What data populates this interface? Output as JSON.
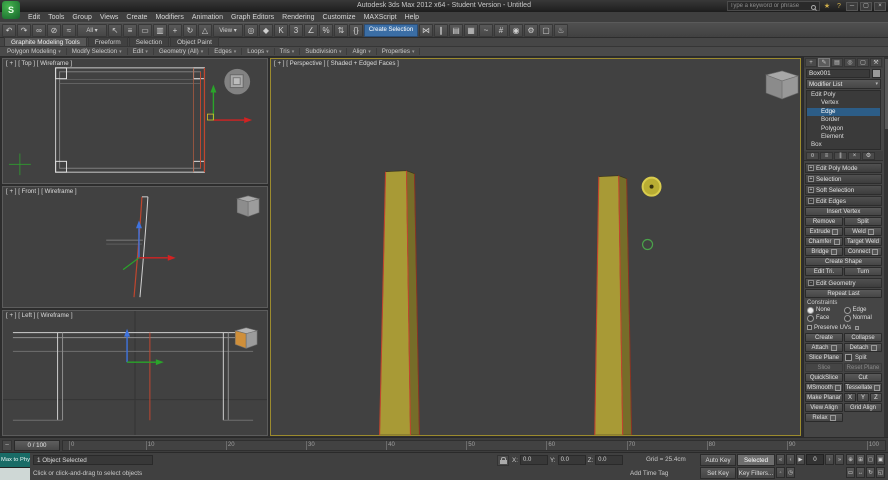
{
  "window": {
    "title": "Autodesk 3ds Max 2012 x64 - Student Version - Untitled",
    "search_placeholder": "Type a keyword or phrase"
  },
  "colors": {
    "selection_blue": "#2c5d87",
    "object_olive": "#a89a36",
    "selected_edge_red": "#c0462e",
    "brush_yellow": "#b9ad33",
    "listener_teal": "#196b66"
  },
  "menubar": [
    {
      "name": "menu-edit",
      "label": "Edit"
    },
    {
      "name": "menu-tools",
      "label": "Tools"
    },
    {
      "name": "menu-group",
      "label": "Group"
    },
    {
      "name": "menu-views",
      "label": "Views"
    },
    {
      "name": "menu-create",
      "label": "Create"
    },
    {
      "name": "menu-modifiers",
      "label": "Modifiers"
    },
    {
      "name": "menu-animation",
      "label": "Animation"
    },
    {
      "name": "menu-graph-editors",
      "label": "Graph Editors"
    },
    {
      "name": "menu-rendering",
      "label": "Rendering"
    },
    {
      "name": "menu-customize",
      "label": "Customize"
    },
    {
      "name": "menu-maxscript",
      "label": "MAXScript"
    },
    {
      "name": "menu-help",
      "label": "Help"
    }
  ],
  "toolbar": {
    "items": [
      {
        "name": "undo-icon",
        "glyph": "↶"
      },
      {
        "name": "redo-icon",
        "glyph": "↷"
      },
      {
        "name": "select-and-link-icon",
        "glyph": "∞"
      },
      {
        "name": "unlink-selection-icon",
        "glyph": "⊘"
      },
      {
        "name": "bind-to-space-warp-icon",
        "glyph": "≈"
      },
      {
        "name": "selection-filter-dropdown",
        "cls": "drop",
        "glyph": "All ▾"
      },
      {
        "name": "select-object-icon",
        "glyph": "↖"
      },
      {
        "name": "select-by-name-icon",
        "glyph": "≡"
      },
      {
        "name": "rectangular-selection-region-icon",
        "glyph": "▭"
      },
      {
        "name": "window-crossing-toggle-icon",
        "glyph": "▥"
      },
      {
        "name": "select-and-move-icon",
        "glyph": "+"
      },
      {
        "name": "select-and-rotate-icon",
        "glyph": "↻"
      },
      {
        "name": "select-and-scale-icon",
        "glyph": "△"
      },
      {
        "name": "reference-coordinate-dropdown",
        "cls": "drop",
        "glyph": "View ▾"
      },
      {
        "name": "use-pivot-point-center-icon",
        "glyph": "◎"
      },
      {
        "name": "select-and-manipulate-icon",
        "glyph": "◆"
      },
      {
        "name": "keyboard-shortcut-override-icon",
        "glyph": "K"
      },
      {
        "name": "snaps-toggle-icon",
        "glyph": "3"
      },
      {
        "name": "angle-snap-toggle-icon",
        "glyph": "∠"
      },
      {
        "name": "percent-snap-toggle-icon",
        "glyph": "%"
      },
      {
        "name": "spinner-snap-toggle-icon",
        "glyph": "⇅"
      },
      {
        "name": "edit-named-selection-sets-icon",
        "glyph": "{}"
      },
      {
        "name": "named-selection-set-dropdown",
        "cls": "drop wide",
        "glyph": "Create Selection"
      },
      {
        "name": "mirror-icon",
        "glyph": "⋈"
      },
      {
        "name": "align-icon",
        "glyph": "∥"
      },
      {
        "name": "layer-manager-icon",
        "glyph": "▤"
      },
      {
        "name": "graphite-ribbon-toggle-icon",
        "glyph": "▦"
      },
      {
        "name": "curve-editor-icon",
        "glyph": "~"
      },
      {
        "name": "schematic-view-icon",
        "glyph": "#"
      },
      {
        "name": "material-editor-icon",
        "glyph": "◉"
      },
      {
        "name": "render-setup-icon",
        "glyph": "⚙"
      },
      {
        "name": "rendered-frame-window-icon",
        "glyph": "▢"
      },
      {
        "name": "render-production-icon",
        "glyph": "♨"
      }
    ]
  },
  "ribbon": {
    "tabs": [
      {
        "name": "tab-graphite-modeling-tools",
        "label": "Graphite Modeling Tools",
        "cls": "active"
      },
      {
        "name": "tab-freeform",
        "label": "Freeform"
      },
      {
        "name": "tab-selection",
        "label": "Selection"
      },
      {
        "name": "tab-object-paint",
        "label": "Object Paint"
      }
    ],
    "panels": [
      {
        "name": "panel-polygon-modeling",
        "label": "Polygon Modeling"
      },
      {
        "name": "panel-modify-selection",
        "label": "Modify Selection"
      },
      {
        "name": "panel-edit",
        "label": "Edit"
      },
      {
        "name": "panel-geometry-all",
        "label": "Geometry (All)"
      },
      {
        "name": "panel-edges",
        "label": "Edges"
      },
      {
        "name": "panel-loops",
        "label": "Loops"
      },
      {
        "name": "panel-tris",
        "label": "Tris"
      },
      {
        "name": "panel-subdivision",
        "label": "Subdivision"
      },
      {
        "name": "panel-align",
        "label": "Align"
      },
      {
        "name": "panel-properties",
        "label": "Properties"
      }
    ]
  },
  "viewports": {
    "top_label": "[ + ] [ Top ] [ Wireframe ]",
    "front_label": "[ + ] [ Front ] [ Wireframe ]",
    "left_label": "[ + ] [ Left ] [ Wireframe ]",
    "persp_label": "[ + ] [ Perspective ] [ Shaded + Edged Faces ]"
  },
  "command_panel": {
    "tabs": [
      {
        "name": "create-tab",
        "glyph": "+"
      },
      {
        "name": "modify-tab",
        "glyph": "✎",
        "cls": "active"
      },
      {
        "name": "hierarchy-tab",
        "glyph": "▤"
      },
      {
        "name": "motion-tab",
        "glyph": "◎"
      },
      {
        "name": "display-tab",
        "glyph": "▢"
      },
      {
        "name": "utilities-tab",
        "glyph": "⚒"
      }
    ],
    "object_name": "Box001",
    "modifier_list": "Modifier List",
    "stack": [
      {
        "name": "stack-edit-poly",
        "label": "Edit Poly"
      },
      {
        "name": "stack-vertex",
        "label": "Vertex",
        "cls": "ind"
      },
      {
        "name": "stack-edge",
        "label": "Edge",
        "cls": "ind sel"
      },
      {
        "name": "stack-border",
        "label": "Border",
        "cls": "ind"
      },
      {
        "name": "stack-polygon",
        "label": "Polygon",
        "cls": "ind"
      },
      {
        "name": "stack-element",
        "label": "Element",
        "cls": "ind"
      },
      {
        "name": "stack-box",
        "label": "Box"
      }
    ],
    "stack_tools": [
      {
        "name": "pin-stack-button",
        "glyph": "¤"
      },
      {
        "name": "show-end-result-button",
        "glyph": "≡"
      },
      {
        "name": "make-unique-button",
        "glyph": "∥"
      },
      {
        "name": "remove-modifier-button",
        "glyph": "×"
      },
      {
        "name": "configure-modifier-sets-button",
        "glyph": "⚙"
      }
    ],
    "rollouts_collapsed": [
      {
        "name": "rollout-edit-poly-mode",
        "state": "+",
        "label": "Edit Poly Mode"
      },
      {
        "name": "rollout-selection",
        "state": "+",
        "label": "Selection"
      },
      {
        "name": "rollout-soft-selection",
        "state": "+",
        "label": "Soft Selection"
      }
    ],
    "edit_edges": {
      "state": "-",
      "title": "Edit Edges",
      "buttons": [
        {
          "name": "insert-vertex-button",
          "label": "Insert Vertex",
          "cls": "full"
        },
        {
          "name": "remove-button",
          "label": "Remove"
        },
        {
          "name": "split-button",
          "label": "Split"
        },
        {
          "name": "extrude-button",
          "label": "Extrude",
          "cls": "set"
        },
        {
          "name": "weld-button",
          "label": "Weld",
          "cls": "set"
        },
        {
          "name": "chamfer-button",
          "label": "Chamfer",
          "cls": "set"
        },
        {
          "name": "target-weld-button",
          "label": "Target Weld"
        },
        {
          "name": "bridge-button",
          "label": "Bridge",
          "cls": "set"
        },
        {
          "name": "connect-button",
          "label": "Connect",
          "cls": "set"
        },
        {
          "name": "create-shape-button",
          "label": "Create Shape",
          "cls": "full"
        },
        {
          "name": "edit-tri-button",
          "label": "Edit Tri."
        },
        {
          "name": "turn-button",
          "label": "Turn"
        }
      ]
    },
    "edit_geometry": {
      "state": "-",
      "title": "Edit Geometry",
      "buttons_top": [
        {
          "name": "repeat-last-button",
          "label": "Repeat Last",
          "cls": "full"
        }
      ],
      "constraints": {
        "label": "Constraints",
        "options": [
          {
            "name": "constraint-none-radio",
            "label": "None",
            "cls": "sel"
          },
          {
            "name": "constraint-edge-radio",
            "label": "Edge"
          },
          {
            "name": "constraint-face-radio",
            "label": "Face"
          },
          {
            "name": "constraint-normal-radio",
            "label": "Normal"
          }
        ]
      },
      "preserve_uvs_label": "Preserve UVs",
      "buttons": [
        {
          "name": "create-button",
          "label": "Create"
        },
        {
          "name": "collapse-button",
          "label": "Collapse"
        },
        {
          "name": "attach-button",
          "label": "Attach",
          "cls": "set"
        },
        {
          "name": "detach-button",
          "label": "Detach",
          "cls": "set"
        },
        {
          "name": "slice-plane-button",
          "label": "Slice Plane"
        },
        {
          "name": "split-checkbox",
          "label": "Split",
          "cls": "check"
        },
        {
          "name": "slice-button",
          "label": "Slice",
          "cls": "disabled"
        },
        {
          "name": "reset-plane-button",
          "label": "Reset Plane",
          "cls": "disabled"
        },
        {
          "name": "quickslice-button",
          "label": "QuickSlice"
        },
        {
          "name": "cut-button",
          "label": "Cut"
        },
        {
          "name": "msmooth-button",
          "label": "MSmooth",
          "cls": "set"
        },
        {
          "name": "tessellate-button",
          "label": "Tessellate",
          "cls": "set"
        },
        {
          "name": "make-planar-button",
          "label": "Make Planar"
        },
        {
          "name": "make-planar-x-button",
          "label": "X",
          "cls": "tiny"
        },
        {
          "name": "make-planar-y-button",
          "label": "Y",
          "cls": "tiny"
        },
        {
          "name": "make-planar-z-button",
          "label": "Z",
          "cls": "tiny"
        },
        {
          "name": "view-align-button",
          "label": "View Align"
        },
        {
          "name": "grid-align-button",
          "label": "Grid Align"
        },
        {
          "name": "relax-button",
          "label": "Relax",
          "cls": "set"
        }
      ]
    }
  },
  "timeline": {
    "slider_label": "0 / 100",
    "ticks": [
      "0",
      "10",
      "20",
      "30",
      "40",
      "50",
      "60",
      "70",
      "80",
      "90",
      "100"
    ]
  },
  "statusbar": {
    "listener_label": "Max to Physx",
    "status": "1 Object Selected",
    "prompt": "Click or click-and-drag to select objects",
    "coords": {
      "x_label": "X:",
      "y_label": "Y:",
      "z_label": "Z:",
      "x": "0.0",
      "y": "0.0",
      "z": "0.0"
    },
    "grid": "Grid = 25.4cm",
    "time_tag": "Add Time Tag",
    "auto_key": "Auto Key",
    "set_key": "Set Key",
    "selected_mode": "Selected",
    "key_filters": "Key Filters...",
    "frame": "0",
    "transport_left": [
      {
        "name": "go-to-start-button",
        "glyph": "«"
      },
      {
        "name": "previous-frame-button",
        "glyph": "‹"
      },
      {
        "name": "play-button",
        "glyph": "▶"
      }
    ],
    "transport_right": [
      {
        "name": "next-frame-button",
        "glyph": "›"
      },
      {
        "name": "go-to-end-button",
        "glyph": "»"
      }
    ],
    "transport_row2": [
      {
        "name": "key-mode-toggle-button",
        "glyph": "◦"
      },
      {
        "name": "time-configuration-button",
        "glyph": "◷"
      }
    ],
    "nav": [
      {
        "name": "zoom-icon",
        "glyph": "⊕"
      },
      {
        "name": "zoom-all-icon",
        "glyph": "⊞"
      },
      {
        "name": "zoom-extents-icon",
        "glyph": "▢"
      },
      {
        "name": "zoom-extents-all-icon",
        "glyph": "▣"
      },
      {
        "name": "zoom-region-icon",
        "glyph": "▭"
      },
      {
        "name": "pan-icon",
        "glyph": "↔"
      },
      {
        "name": "orbit-icon",
        "glyph": "↻"
      },
      {
        "name": "maximize-viewport-toggle-icon",
        "glyph": "◱"
      }
    ]
  }
}
